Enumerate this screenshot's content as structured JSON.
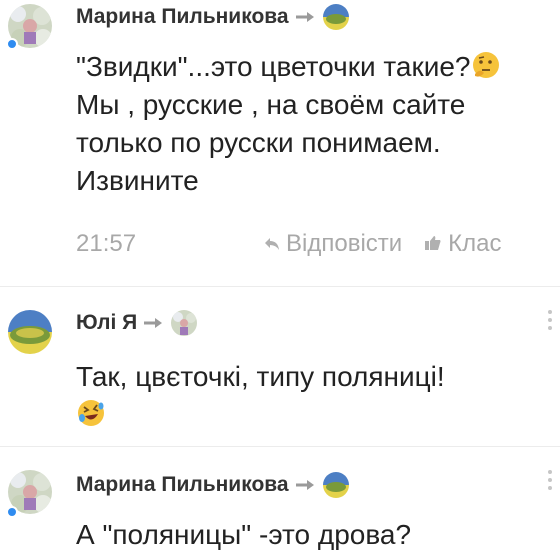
{
  "comments": [
    {
      "author": "Марина Пильникова",
      "text_1": "\"Звидки\"...это цветочки такие?",
      "text_2": " Мы , русские , на своём сайте только по русски понимаем. Извините",
      "time": "21:57",
      "reply_label": "Відповісти",
      "like_label": "Клас"
    },
    {
      "author": "Юлі Я",
      "text": "Так, цвєточкі, типу поляниці!"
    },
    {
      "author": "Марина Пильникова",
      "text": "А \"поляницы\" -это дрова?"
    }
  ],
  "icons": {
    "thinking_emoji": "thinking-face",
    "laughing_emoji": "rolling-on-floor-laughing",
    "reply": "reply-arrow",
    "like": "thumbs-up",
    "menu": "vertical-dots"
  },
  "colors": {
    "accent": "#2f8cf0",
    "muted": "#a8a8a8",
    "flag_blue": "#4d7fc4",
    "flag_yellow": "#e3d24a"
  }
}
